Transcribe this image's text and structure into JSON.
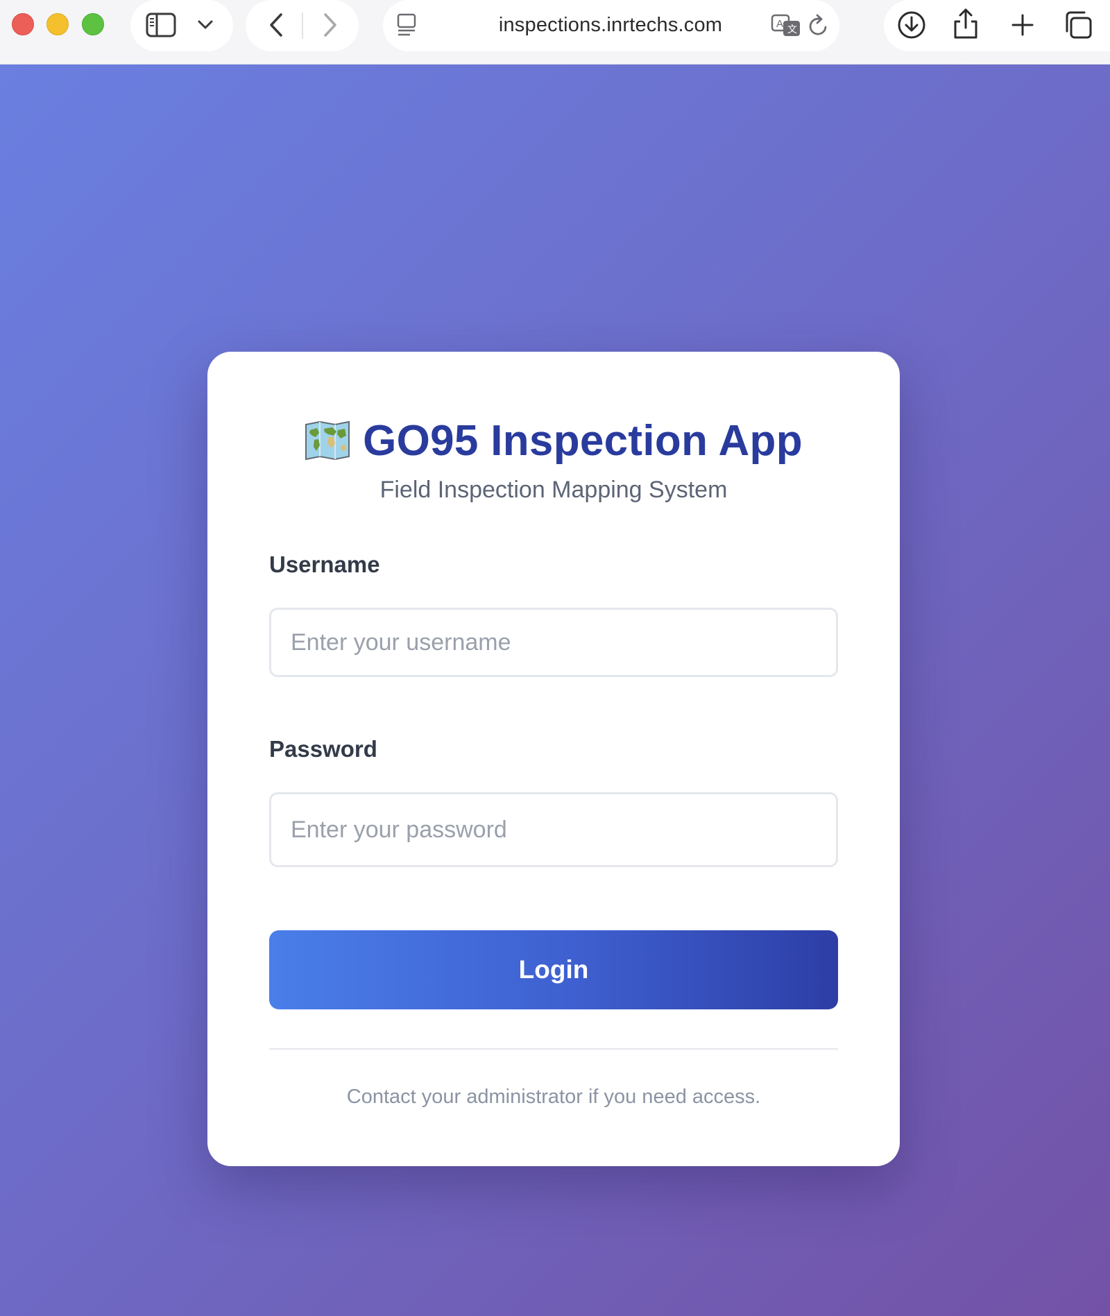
{
  "browser": {
    "url": "inspections.inrtechs.com",
    "icons": {
      "sidebar": "sidebar-icon",
      "tab_menu": "chevron-down-icon",
      "back": "chevron-left-icon",
      "forward": "chevron-right-icon",
      "reader": "page-menu-icon",
      "translate": "translate-icon",
      "reload": "reload-icon",
      "download": "download-icon",
      "share": "share-icon",
      "new_tab": "plus-icon",
      "tabs": "tabs-overview-icon"
    }
  },
  "login": {
    "title": "GO95 Inspection App",
    "title_icon": "world-map-icon",
    "subtitle": "Field Inspection Mapping System",
    "username_label": "Username",
    "username_placeholder": "Enter your username",
    "username_value": "",
    "password_label": "Password",
    "password_placeholder": "Enter your password",
    "password_value": "",
    "submit_label": "Login",
    "footer": "Contact your administrator if you need access."
  },
  "colors": {
    "background_gradient_start": "#6a7fe0",
    "background_gradient_end": "#7352a6",
    "title": "#2a3b9e",
    "button_start": "#4a7ee9",
    "button_end": "#2d3ea6"
  }
}
